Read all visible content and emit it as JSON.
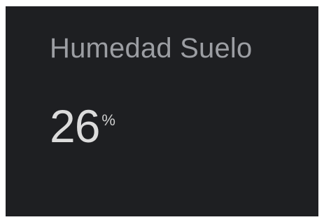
{
  "widget": {
    "title": "Humedad Suelo",
    "value": "26",
    "unit": "%",
    "colors": {
      "background": "#1e1f22",
      "title": "#9c9ea3",
      "value": "#dcdcdc"
    }
  }
}
